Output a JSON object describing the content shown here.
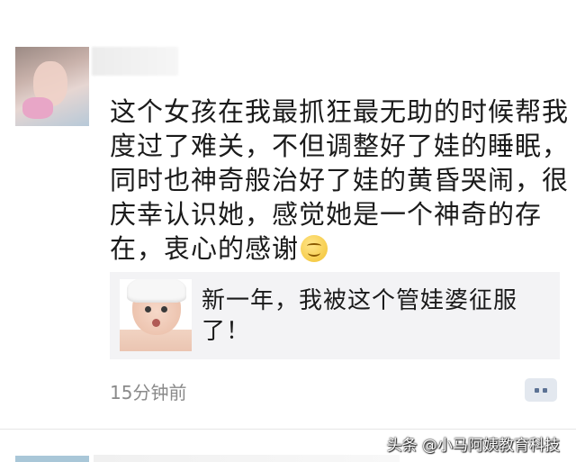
{
  "post": {
    "content": "这个女孩在我最抓狂最无助的时候帮我度过了难关，不但调整好了娃的睡眠，同时也神奇般治好了娃的黄昏哭闹，很庆幸认识她，感觉她是一个神奇的存在，衷心的感谢",
    "emoji": "smile-emoji",
    "link_card": {
      "title": "新一年，我被这个管娃婆征服了！"
    },
    "timestamp": "15分钟前",
    "comment_icon": "comment-more-icon"
  },
  "watermark": "头条 @小马阿姨教育科技"
}
